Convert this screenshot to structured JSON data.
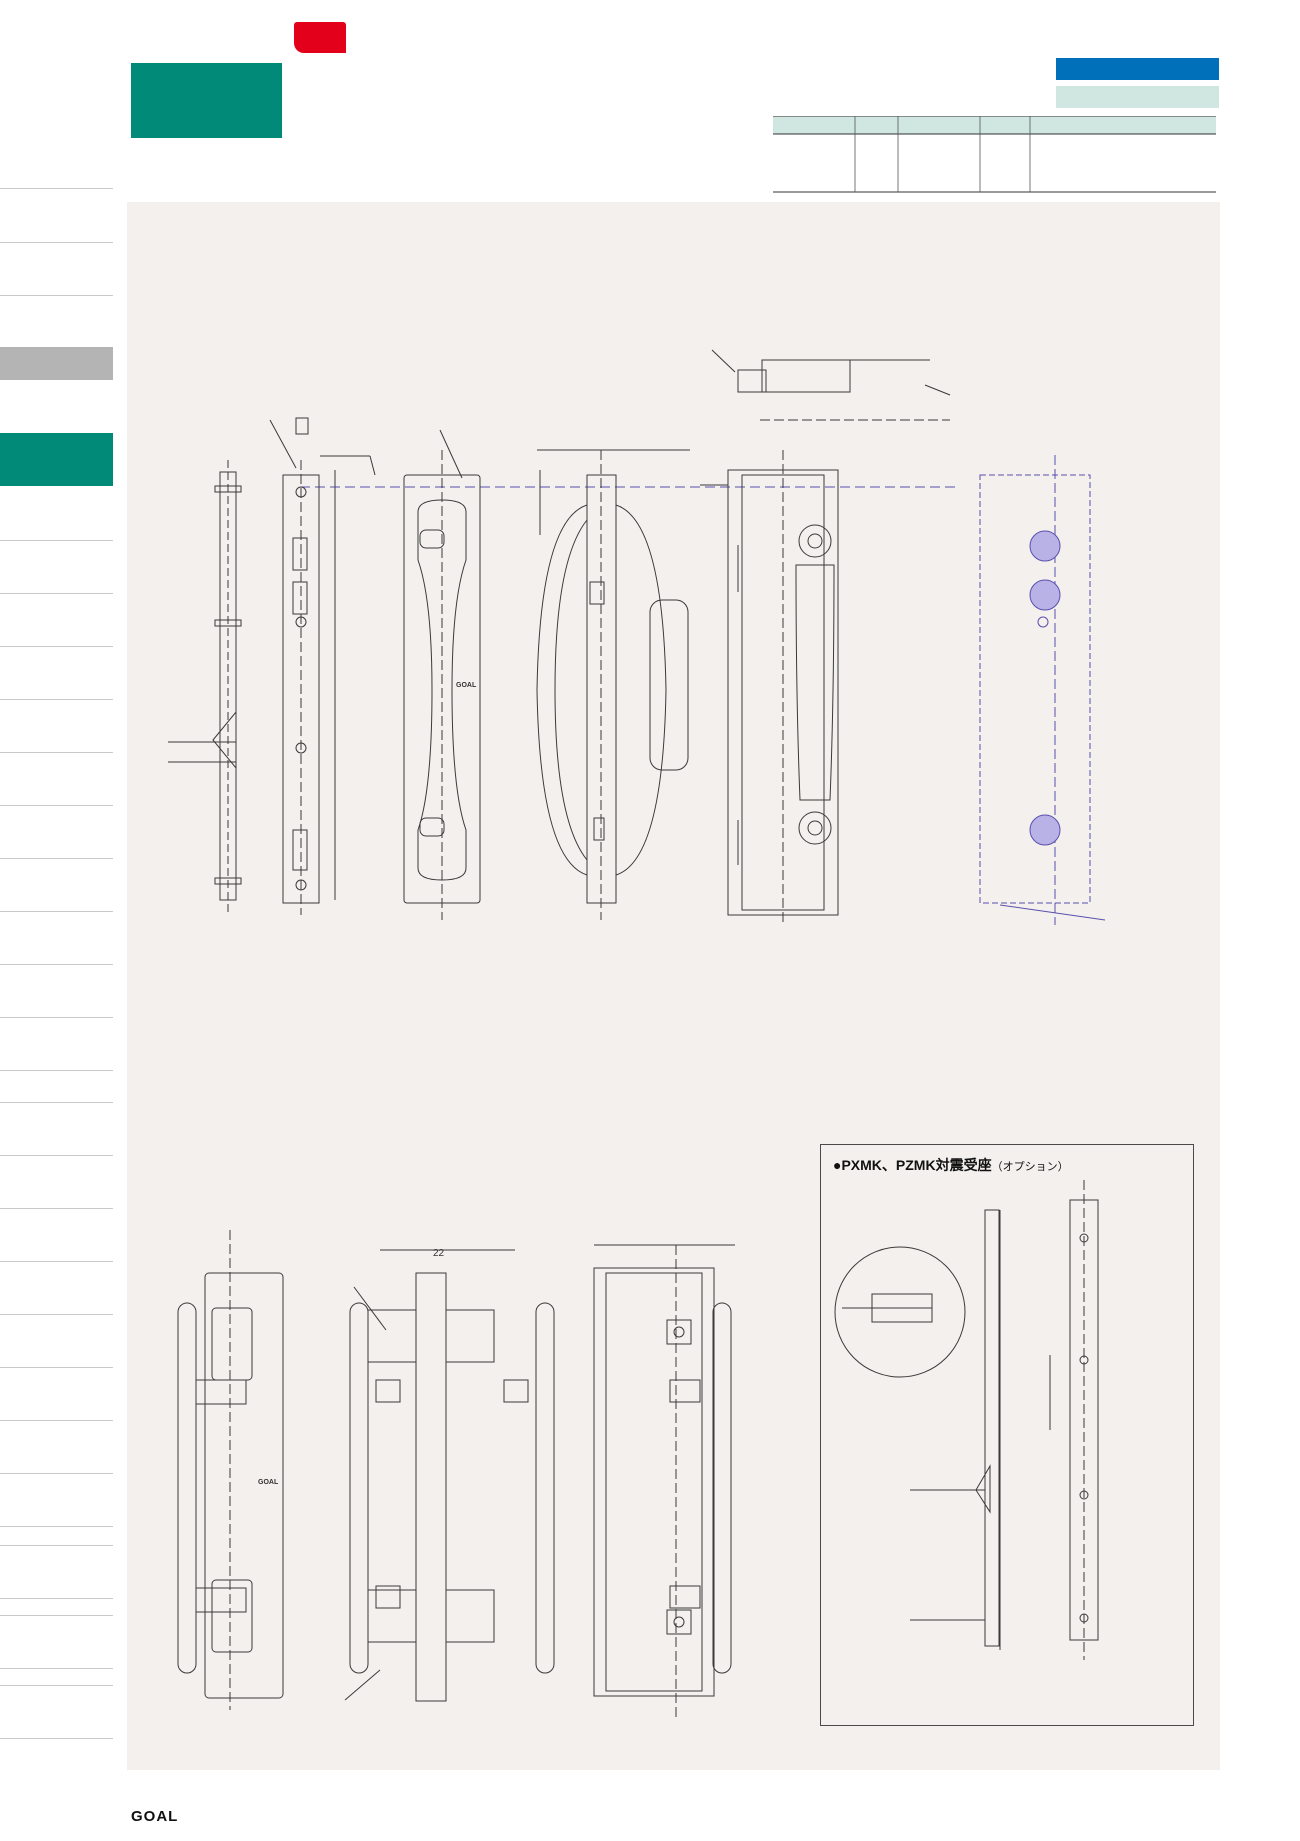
{
  "header": {
    "colors": {
      "green_block": "#008a77",
      "red_tab": "#e3001b",
      "blue_bar": "#0070bb",
      "mint_bar": "#cfe6e1"
    }
  },
  "sidebar": {
    "active_tab_color": "#008a77",
    "gray_tab_color": "#b4b4b4"
  },
  "inset": {
    "title": "●PXMK、PZMK対震受座",
    "option": "（オプション）"
  },
  "dimensions": {
    "label_22": "22"
  },
  "drawing_marks": {
    "brand_mark_1": "GOAL",
    "brand_mark_2": "GOAL"
  },
  "footer": {
    "logo": "GOAL"
  }
}
